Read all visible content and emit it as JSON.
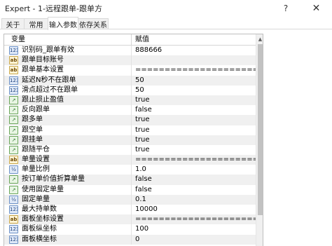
{
  "window": {
    "title": "Expert - 1-远程跟单-跟单方",
    "help_glyph": "?",
    "close_glyph": "✕"
  },
  "tabs": [
    {
      "label": "关于",
      "active": false
    },
    {
      "label": "常用",
      "active": false
    },
    {
      "label": "输入参数",
      "active": true
    },
    {
      "label": "依存关系",
      "active": false
    }
  ],
  "grid": {
    "col_variable": "变量",
    "col_value": "赋值",
    "rows": [
      {
        "icon": "num",
        "icon_text": "123",
        "name": "识别码_跟单有效",
        "value": "888666"
      },
      {
        "icon": "ab",
        "icon_text": "ab",
        "name": "跟单目标账号",
        "value": ""
      },
      {
        "icon": "ab",
        "icon_text": "ab",
        "name": "跟单基本设置",
        "value": "======================"
      },
      {
        "icon": "num",
        "icon_text": "123",
        "name": "延迟N秒不在跟单",
        "value": "50"
      },
      {
        "icon": "num",
        "icon_text": "123",
        "name": "滑点超过不在跟单",
        "value": "50"
      },
      {
        "icon": "bool",
        "icon_text": "↗",
        "name": "跟止损止盈值",
        "value": "true"
      },
      {
        "icon": "bool",
        "icon_text": "↗",
        "name": "反向跟单",
        "value": "false"
      },
      {
        "icon": "bool",
        "icon_text": "↗",
        "name": "跟多单",
        "value": "true"
      },
      {
        "icon": "bool",
        "icon_text": "↗",
        "name": "跟空单",
        "value": "true"
      },
      {
        "icon": "bool",
        "icon_text": "↗",
        "name": "跟挂单",
        "value": "true"
      },
      {
        "icon": "bool",
        "icon_text": "↗",
        "name": "跟随平仓",
        "value": "true"
      },
      {
        "icon": "ab",
        "icon_text": "ab",
        "name": "单量设置",
        "value": "======================"
      },
      {
        "icon": "num",
        "icon_text": "½",
        "name": "单量比例",
        "value": "1.0"
      },
      {
        "icon": "bool",
        "icon_text": "↗",
        "name": "按订单价值折算单量",
        "value": "false"
      },
      {
        "icon": "bool",
        "icon_text": "↗",
        "name": "使用固定单量",
        "value": "false"
      },
      {
        "icon": "num",
        "icon_text": "½",
        "name": "固定单量",
        "value": "0.1"
      },
      {
        "icon": "num",
        "icon_text": "123",
        "name": "最大持单数",
        "value": "10000"
      },
      {
        "icon": "ab",
        "icon_text": "ab",
        "name": "面板坐标设置",
        "value": "======================"
      },
      {
        "icon": "num",
        "icon_text": "123",
        "name": "面板纵坐标",
        "value": "100"
      },
      {
        "icon": "num",
        "icon_text": "123",
        "name": "面板横坐标",
        "value": "0"
      }
    ]
  }
}
